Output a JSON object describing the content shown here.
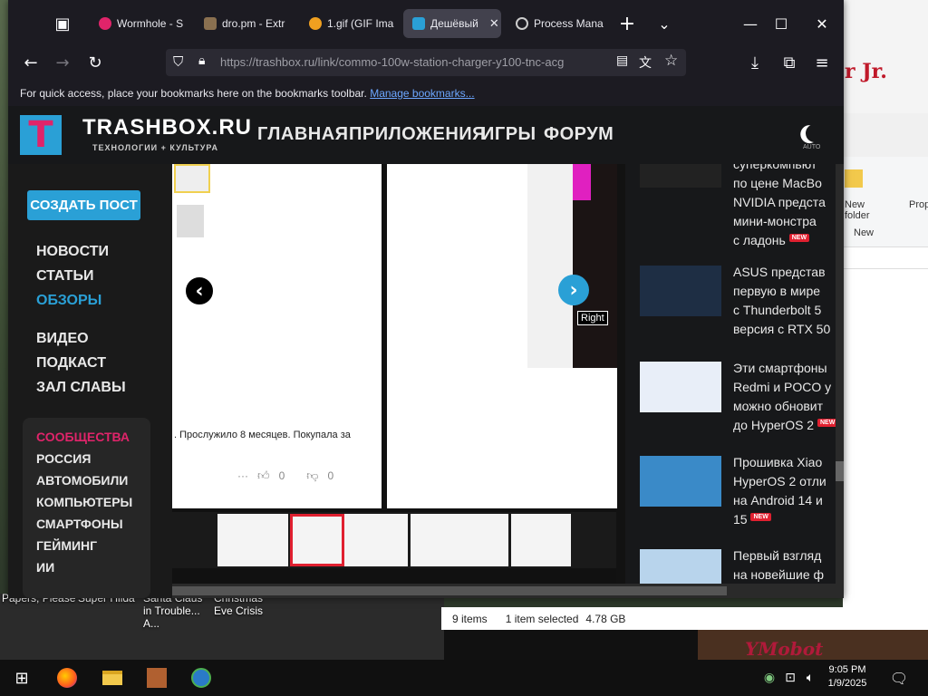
{
  "desktop": {
    "bg_text": "r Jr.",
    "bg_bottom_text": "YMobot",
    "icons": [
      {
        "label": "Papers, Please"
      },
      {
        "label": "Super Hilda"
      },
      {
        "label": "Santa Claus in Trouble... A..."
      },
      {
        "label": "Christmas Eve Crisis"
      }
    ]
  },
  "explorer": {
    "ribbon_new_folder": "New folder",
    "ribbon_group": "New",
    "ribbon_prop": "Prop",
    "status_items": "9 items",
    "status_selected": "1 item selected",
    "status_size": "4.78 GB"
  },
  "browser": {
    "tabs": [
      {
        "title": "Wormhole - S",
        "color": "#e0246a"
      },
      {
        "title": "dro.pm - Extr",
        "color": "#8a7050"
      },
      {
        "title": "1.gif (GIF Ima",
        "color": "#f0a020"
      },
      {
        "title": "Дешёвый",
        "color": "#2aa0d6"
      },
      {
        "title": "Process Mana",
        "color": "#cccccc"
      }
    ],
    "new_tab": "+",
    "tab_list": "⌄",
    "url": "https://trashbox.ru/link/commo-100w-station-charger-y100-tnc-acg",
    "bookmarks_text": "For quick access, place your bookmarks here on the bookmarks toolbar.",
    "bookmarks_link": "Manage bookmarks..."
  },
  "site": {
    "logo_letter": "T",
    "title": "TRASHBOX.RU",
    "subtitle": "ТЕХНОЛОГИИ + КУЛЬТУРА",
    "nav": [
      "ГЛАВНАЯ",
      "ПРИЛОЖЕНИЯ",
      "ИГРЫ",
      "ФОРУМ"
    ],
    "theme_label": "AUTO",
    "create_post": "СОЗДАТЬ ПОСТ",
    "sidebar": [
      "НОВОСТИ",
      "СТАТЬИ",
      "ОБЗОРЫ",
      "ВИДЕО",
      "ПОДКАСТ",
      "ЗАЛ СЛАВЫ"
    ],
    "active_color": "#2aa0d6",
    "communities": [
      "СООБЩЕСТВА",
      "РОССИЯ",
      "АВТОМОБИЛИ",
      "КОМПЬЮТЕРЫ",
      "СМАРТФОНЫ",
      "ГЕЙМИНГ",
      "ИИ"
    ],
    "community_color": "#e0246a"
  },
  "gallery": {
    "review_text": ". Прослужило 8 месяцев. Покупала за",
    "likes": "0",
    "dislikes": "0",
    "dots": "···",
    "prev": "‹",
    "next": "›",
    "tooltip": "Right"
  },
  "news": {
    "new_badge": "NEW",
    "items": [
      {
        "text": "суперкомпьют\nпо цене MacBo\nNVIDIA предста\nмини-монстра\nс ладонь",
        "new": true
      },
      {
        "text": "ASUS представ\nпервую в мире\nс Thunderbolt 5\nверсия с RTX 50",
        "new": false
      },
      {
        "text": "Эти смартфоны\nRedmi и POCO у\nможно обновит\nдо HyperOS 2",
        "new": true
      },
      {
        "text": "Прошивка Xiao\nHyperOS 2 отли\nна Android 14 и\n15",
        "new": true
      },
      {
        "text": "Первый взгляд\nна новейшие ф",
        "new": false
      }
    ]
  },
  "taskbar": {
    "time": "9:05 PM",
    "date": "1/9/2025"
  }
}
